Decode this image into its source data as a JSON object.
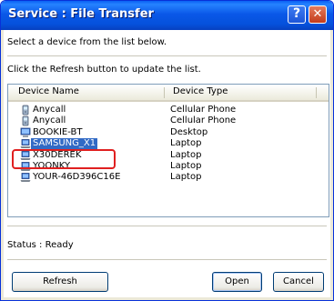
{
  "window": {
    "title": "Service : File Transfer",
    "help_glyph": "?",
    "close_glyph": "✕"
  },
  "instructions": {
    "line1": "Select a device from the list below.",
    "line2": "Click the Refresh button to update the list."
  },
  "list": {
    "columns": [
      "Device Name",
      "Device Type"
    ],
    "rows": [
      {
        "name": "Anycall",
        "type": "Cellular Phone",
        "icon": "phone-icon"
      },
      {
        "name": "Anycall",
        "type": "Cellular Phone",
        "icon": "phone-icon"
      },
      {
        "name": "BOOKIE-BT",
        "type": "Desktop",
        "icon": "desktop-icon"
      },
      {
        "name": "SAMSUNG_X1",
        "type": "Laptop",
        "icon": "laptop-icon",
        "selected": true
      },
      {
        "name": "X30DEREK",
        "type": "Laptop",
        "icon": "laptop-icon"
      },
      {
        "name": "YOONKY",
        "type": "Laptop",
        "icon": "laptop-icon"
      },
      {
        "name": "YOUR-46D396C16E",
        "type": "Laptop",
        "icon": "laptop-icon"
      }
    ]
  },
  "status": "Status : Ready",
  "buttons": {
    "refresh": "Refresh",
    "open": "Open",
    "cancel": "Cancel"
  },
  "colors": {
    "title_bar": "#0a58e8",
    "selection": "#316ac5",
    "callout": "#e02020"
  }
}
